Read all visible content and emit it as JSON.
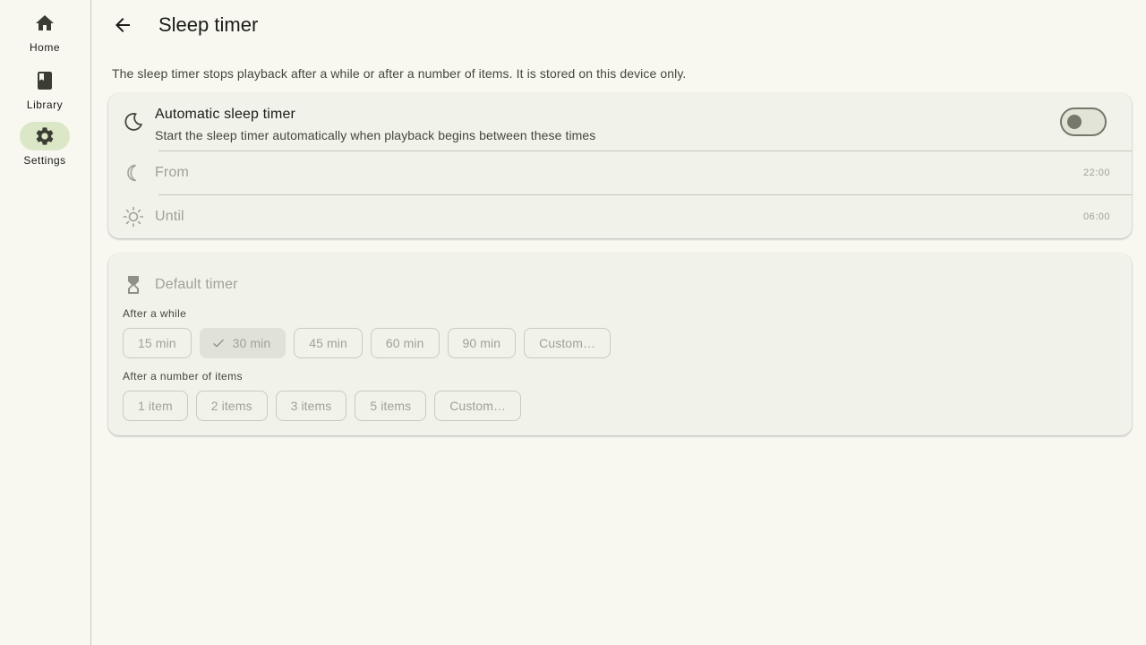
{
  "nav": {
    "items": [
      {
        "label": "Home",
        "icon": "home-icon",
        "active": false
      },
      {
        "label": "Library",
        "icon": "book-icon",
        "active": false
      },
      {
        "label": "Settings",
        "icon": "gear-icon",
        "active": true
      }
    ]
  },
  "header": {
    "title": "Sleep timer"
  },
  "description": "The sleep timer stops playback after a while or after a number of items. It is stored on this device only.",
  "auto_timer": {
    "title": "Automatic sleep timer",
    "subtitle": "Start the sleep timer automatically when playback begins between these times",
    "enabled": false,
    "from_label": "From",
    "from_value": "22:00",
    "until_label": "Until",
    "until_value": "06:00"
  },
  "default_timer": {
    "title": "Default timer",
    "after_while_label": "After a while",
    "durations": [
      "15 min",
      "30 min",
      "45 min",
      "60 min",
      "90 min",
      "Custom…"
    ],
    "selected_duration": "30 min",
    "after_items_label": "After a number of items",
    "item_counts": [
      "1 item",
      "2 items",
      "3 items",
      "5 items",
      "Custom…"
    ]
  },
  "colors": {
    "background": "#f8f8f1",
    "card": "#f1f2ea",
    "rail_active": "#dce7c8",
    "disabled_text": "#a0a297"
  }
}
